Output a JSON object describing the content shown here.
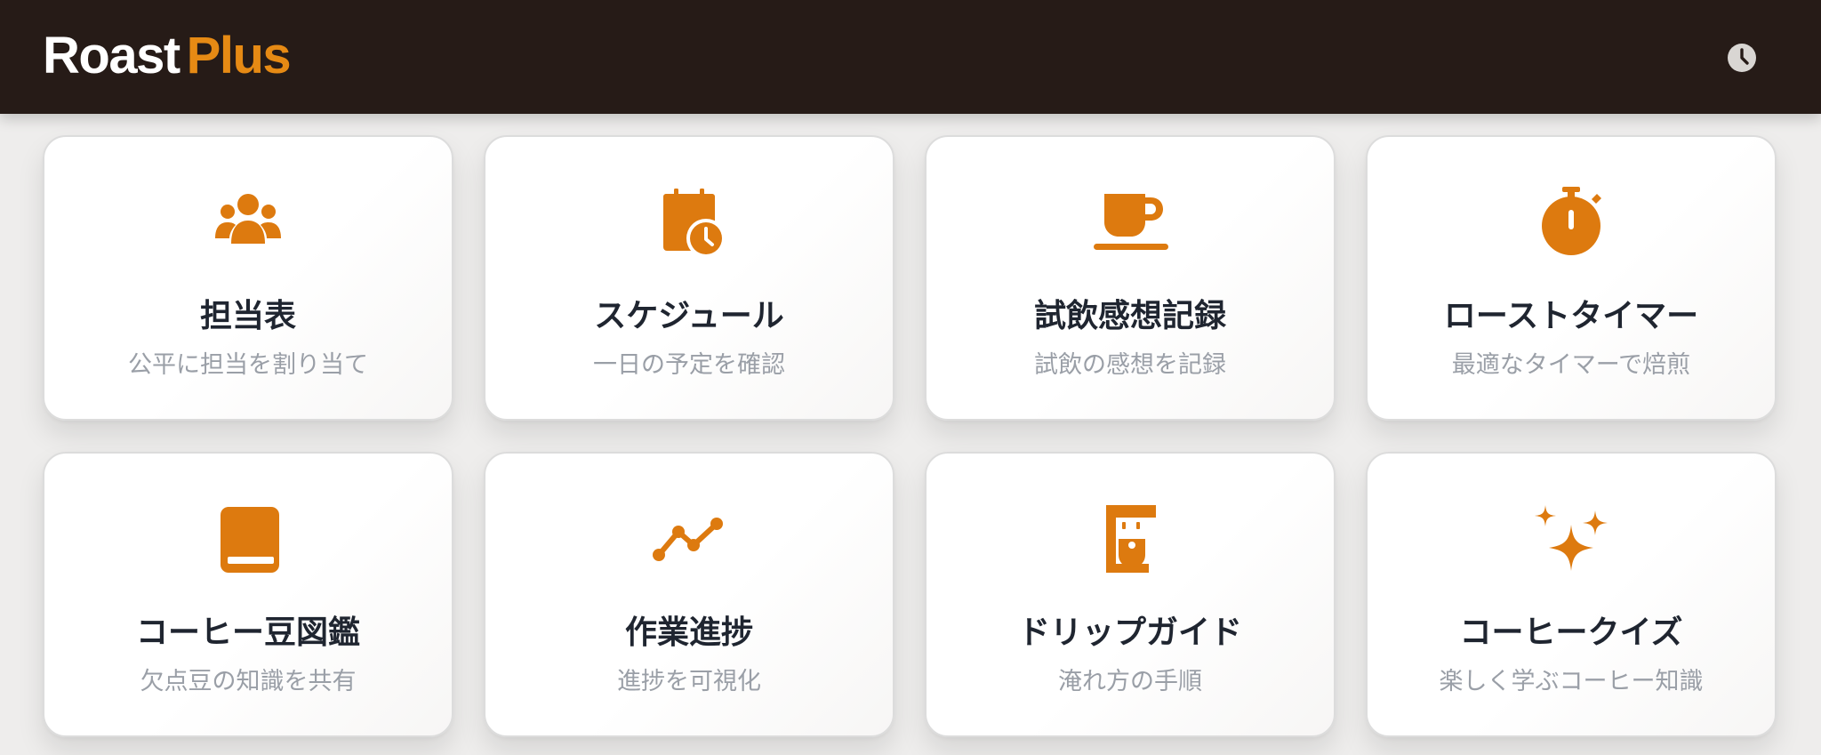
{
  "app": {
    "logo_part1": "Roast",
    "logo_part2": "Plus",
    "accent_color": "#e68a14",
    "header_color": "#261b17",
    "header_icon": "history-clock-icon"
  },
  "cards": [
    {
      "title": "担当表",
      "subtitle": "公平に担当を割り当て",
      "icon": "team-icon"
    },
    {
      "title": "スケジュール",
      "subtitle": "一日の予定を確認",
      "icon": "calendar-clock-icon"
    },
    {
      "title": "試飲感想記録",
      "subtitle": "試飲の感想を記録",
      "icon": "coffee-cup-icon"
    },
    {
      "title": "ローストタイマー",
      "subtitle": "最適なタイマーで焙煎",
      "icon": "stopwatch-icon"
    },
    {
      "title": "コーヒー豆図鑑",
      "subtitle": "欠点豆の知識を共有",
      "icon": "book-icon"
    },
    {
      "title": "作業進捗",
      "subtitle": "進捗を可視化",
      "icon": "progress-line-icon"
    },
    {
      "title": "ドリップガイド",
      "subtitle": "淹れ方の手順",
      "icon": "coffee-maker-icon"
    },
    {
      "title": "コーヒークイズ",
      "subtitle": "楽しく学ぶコーヒー知識",
      "icon": "sparkles-icon"
    }
  ]
}
